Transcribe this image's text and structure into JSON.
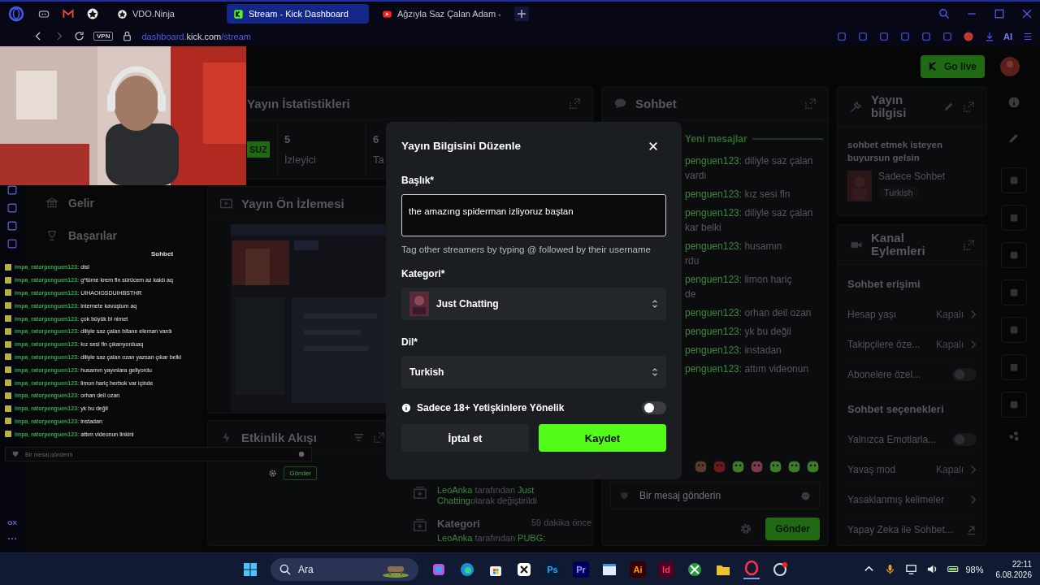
{
  "browser": {
    "tabs": [
      {
        "label": "VDO.Ninja",
        "selected": false
      },
      {
        "label": "Stream - Kick Dashboard",
        "selected": true
      },
      {
        "label": "Ağzıyla Saz Çalan Adam -",
        "selected": false
      }
    ],
    "vpn": "VPN",
    "url": {
      "host_prefix": "dashboard.",
      "domain": "kick.com",
      "path": "/stream"
    },
    "ai_label": "AI",
    "rail_label": "GX"
  },
  "header": {
    "go_live": "Go live"
  },
  "sidebar": {
    "items": [
      {
        "label": "Gelir"
      },
      {
        "label": "Başarılar"
      }
    ]
  },
  "stats": {
    "title": "Yayın İstatistikleri",
    "badge": "SUZ",
    "items": [
      {
        "value": "5",
        "label": "İzleyici"
      },
      {
        "value": "6",
        "label": "Ta"
      }
    ]
  },
  "preview": {
    "title": "Yayın Ön İzlemesi"
  },
  "activity": {
    "title": "Etkinlik Akışı",
    "events": [
      {
        "actor": "LeoAnka",
        "verb": "tarafından",
        "target": "Just Chatting",
        "rest": "olarak değiştirildi"
      },
      {
        "title": "Kategori",
        "time": "59 dakika önce",
        "actor": "LeoAnka",
        "verb": "tarafından",
        "target": "PUBG:"
      }
    ]
  },
  "chat": {
    "title": "Sohbet",
    "new_messages": "Yeni mesajlar",
    "messages": [
      {
        "user": "penguen123:",
        "text": "diliyle saz çalan",
        "cont": "vardı"
      },
      {
        "user": "penguen123:",
        "text": "kız sesi fln"
      },
      {
        "user": "penguen123:",
        "text": "diliyle saz çalan",
        "cont": "kar belki"
      },
      {
        "user": "penguen123:",
        "text": "husamın",
        "cont": "rdu"
      },
      {
        "user": "penguen123:",
        "text": "limon hariç",
        "cont": "de"
      },
      {
        "user": "penguen123:",
        "text": "orhan deil ozan"
      },
      {
        "user": "penguen123:",
        "text": "yk bu değil"
      },
      {
        "user": "penguen123:",
        "text": "instadan"
      },
      {
        "user": "penguen123:",
        "text": "attım videonun"
      }
    ],
    "placeholder": "Bir mesaj gönderin",
    "send": "Gönder"
  },
  "stream_info": {
    "title": "Yayın bilgisi",
    "stream_title": "sohbet etmek isteyen buyursun gelsin",
    "category": "Sadece Sohbet",
    "language": "Turkish"
  },
  "channel_actions": {
    "title": "Kanal Eylemleri",
    "sections": [
      {
        "title": "Sohbet erişimi",
        "items": [
          {
            "kind": "link",
            "label": "Hesap yaşı",
            "value": "Kapalı"
          },
          {
            "kind": "link",
            "label": "Takipçilere öze...",
            "value": "Kapalı"
          },
          {
            "kind": "toggle",
            "label": "Abonelere özel...",
            "on": false
          }
        ]
      },
      {
        "title": "Sohbet seçenekleri",
        "items": [
          {
            "kind": "toggle",
            "label": "Yalnızca Emotlarla...",
            "on": false
          },
          {
            "kind": "link",
            "label": "Yavaş mod",
            "value": "Kapalı"
          },
          {
            "kind": "link",
            "label": "Yasaklanmış kelimeler"
          },
          {
            "kind": "external",
            "label": "Yapay Zeka ile Sohbet..."
          }
        ]
      }
    ]
  },
  "modal": {
    "title": "Yayın Bilgisini Düzenle",
    "title_label": "Başlık*",
    "title_value": "the amazıng spiderman izliyoruz baştan",
    "hint": "Tag other streamers by typing @ followed by their username",
    "category_label": "Kategori*",
    "category": "Just Chatting",
    "language_label": "Dil*",
    "language": "Turkish",
    "mature_label": "Sadece 18+ Yetişkinlere Yönelik",
    "mature": false,
    "cancel": "İptal et",
    "save": "Kaydet"
  },
  "overlay_chat": {
    "title": "Sohbet",
    "messages": [
      {
        "user": "impa_ratorpenguen123:",
        "text": "disl"
      },
      {
        "user": "impa_ratorpenguen123:",
        "text": "g*tüme krem fln sürücem az kaldı aq"
      },
      {
        "user": "impa_ratorpenguen123:",
        "text": "UIHAOIGSDUIHBSTHR"
      },
      {
        "user": "impa_ratorpenguen123:",
        "text": "internete kavuştum aq"
      },
      {
        "user": "impa_ratorpenguen123:",
        "text": "çok büyük bi nimet"
      },
      {
        "user": "impa_ratorpenguen123:",
        "text": "diliyle saz çalan bitane eleman vardı"
      },
      {
        "user": "impa_ratorpenguen123:",
        "text": "kız sesi fln çıkarıyorduaq"
      },
      {
        "user": "impa_ratorpenguen123:",
        "text": "diliyle saz çalan ozan yazsan çıkar belki"
      },
      {
        "user": "impa_ratorpenguen123:",
        "text": "husamın yayınlara geliyordu"
      },
      {
        "user": "impa_ratorpenguen123:",
        "text": "limon hariç herbok var içinde"
      },
      {
        "user": "impa_ratorpenguen123:",
        "text": "orhan deil ozan"
      },
      {
        "user": "impa_ratorpenguen123:",
        "text": "yk bu değil"
      },
      {
        "user": "impa_ratorpenguen123:",
        "text": "instadan"
      },
      {
        "user": "impa_ratorpenguen123:",
        "text": "attım videonun linkini"
      }
    ],
    "placeholder": "Bir mesaj gönderin",
    "send": "Gönder"
  },
  "taskbar": {
    "search": "Ara",
    "app_labels": [
      "Ps",
      "Pr",
      "Ai",
      "Id"
    ],
    "battery": "98%",
    "time": "22:11",
    "date": "6.08.2026"
  }
}
